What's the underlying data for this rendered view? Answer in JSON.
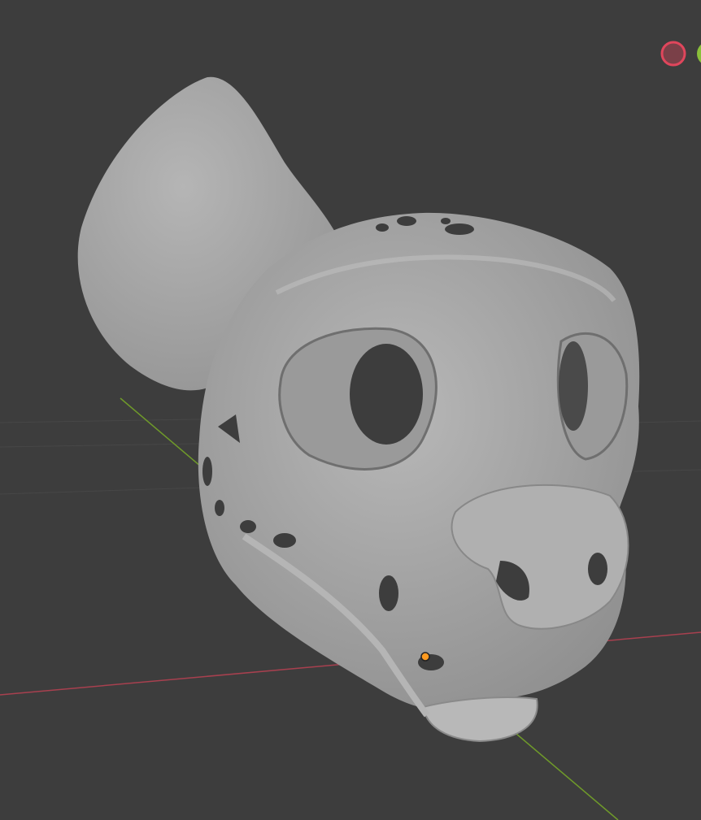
{
  "viewport": {
    "background": "#3d3d3d",
    "grid_color": "#4a4a4a",
    "x_axis_color": "#a8404f",
    "y_axis_color": "#6f9a2a",
    "model_color": "#a9a9a9",
    "origin_color": "#ff9a1f"
  },
  "gizmo": {
    "neg_x_color": "#e0465c",
    "y_color": "#8ac03a"
  }
}
